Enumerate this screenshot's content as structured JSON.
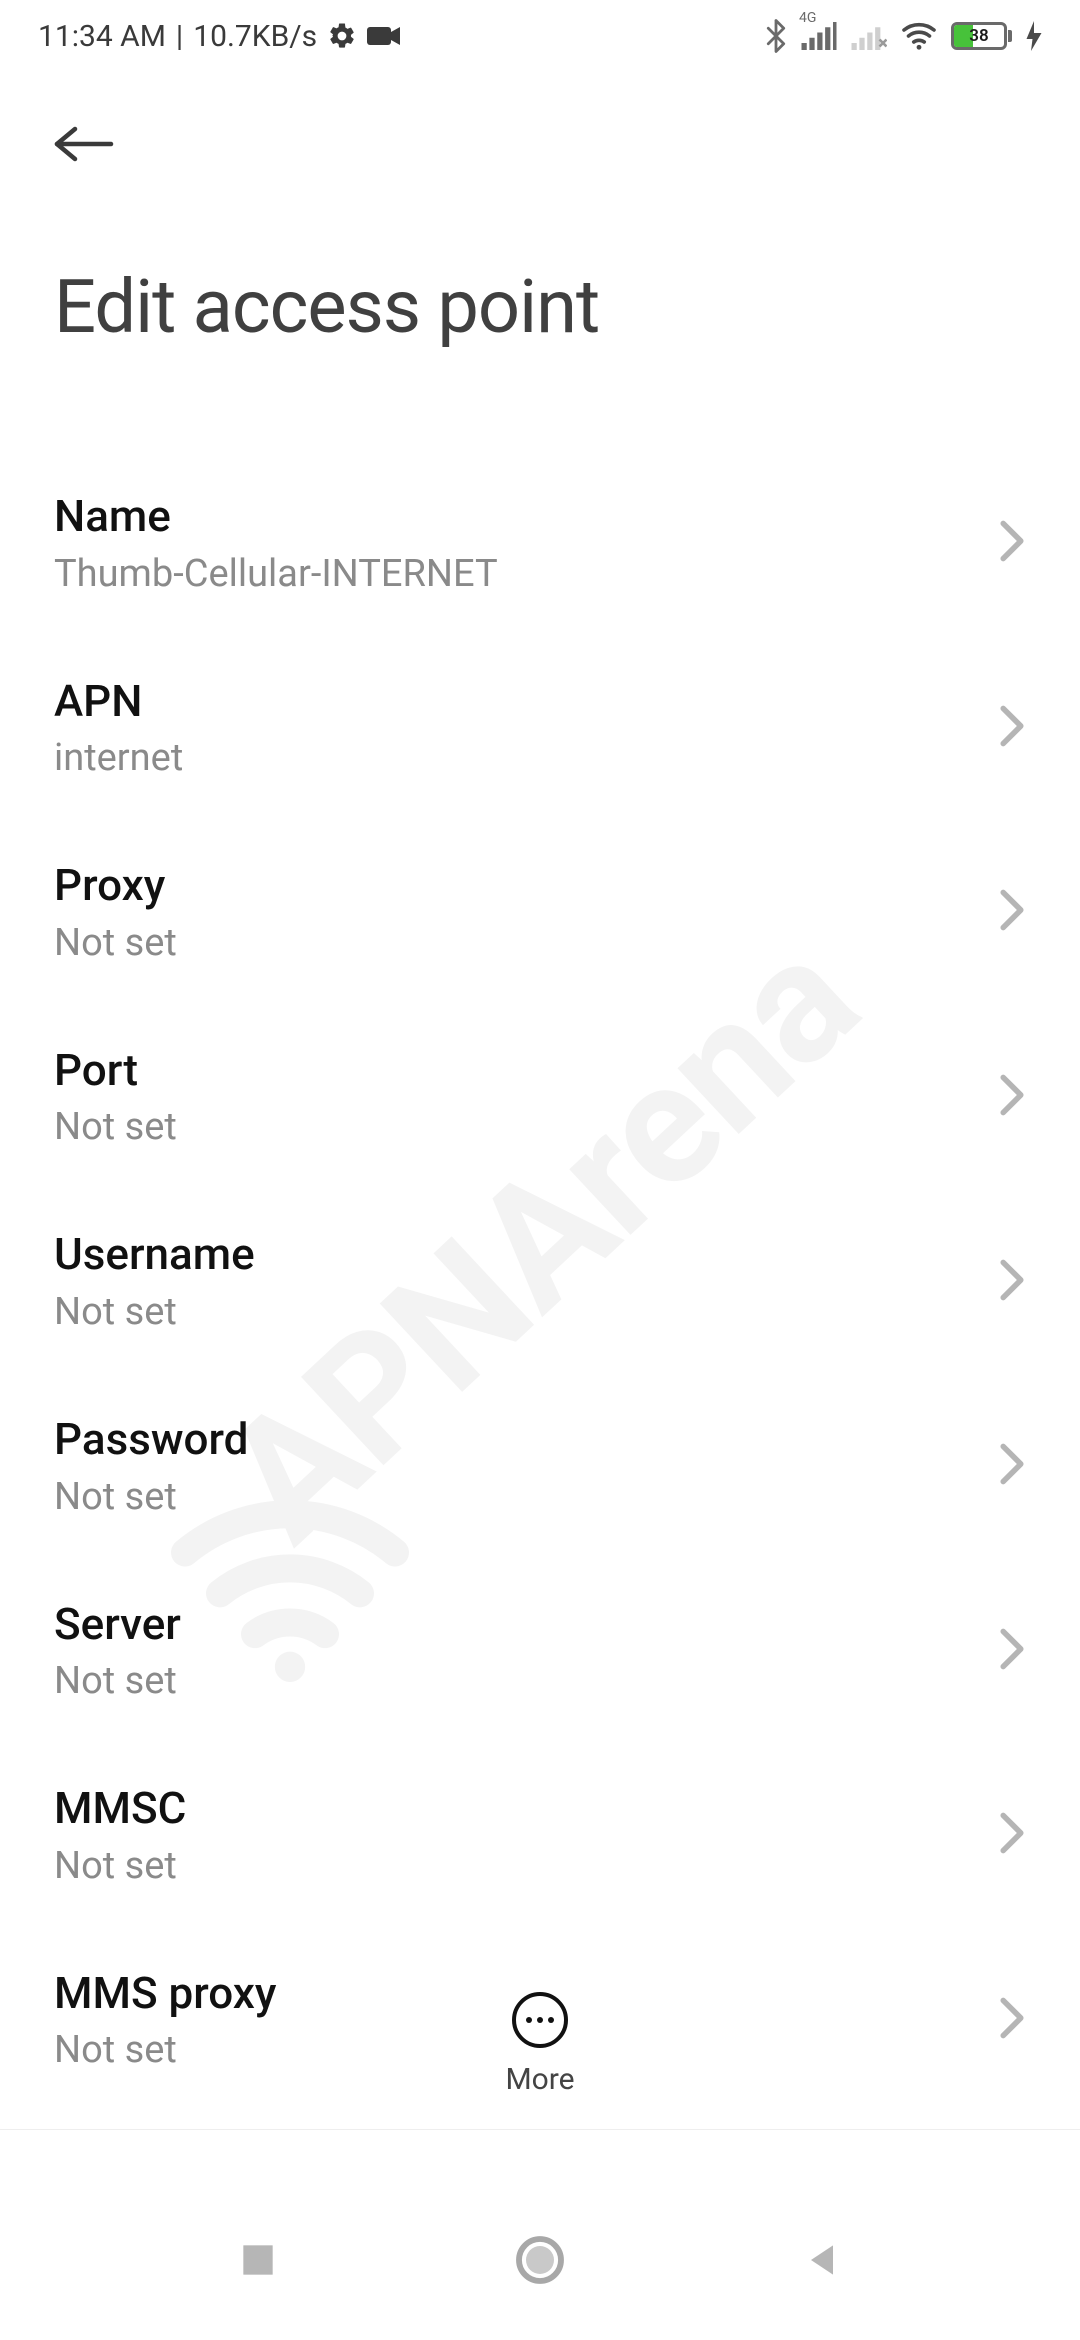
{
  "status": {
    "time": "11:34 AM",
    "net_speed": "10.7KB/s",
    "battery_pct": "38",
    "cell_label": "4G"
  },
  "header": {
    "title": "Edit access point"
  },
  "rows": [
    {
      "label": "Name",
      "value": "Thumb-Cellular-INTERNET"
    },
    {
      "label": "APN",
      "value": "internet"
    },
    {
      "label": "Proxy",
      "value": "Not set"
    },
    {
      "label": "Port",
      "value": "Not set"
    },
    {
      "label": "Username",
      "value": "Not set"
    },
    {
      "label": "Password",
      "value": "Not set"
    },
    {
      "label": "Server",
      "value": "Not set"
    },
    {
      "label": "MMSC",
      "value": "Not set"
    },
    {
      "label": "MMS proxy",
      "value": "Not set"
    }
  ],
  "more": {
    "label": "More"
  },
  "watermark": {
    "text": "APNArena"
  }
}
